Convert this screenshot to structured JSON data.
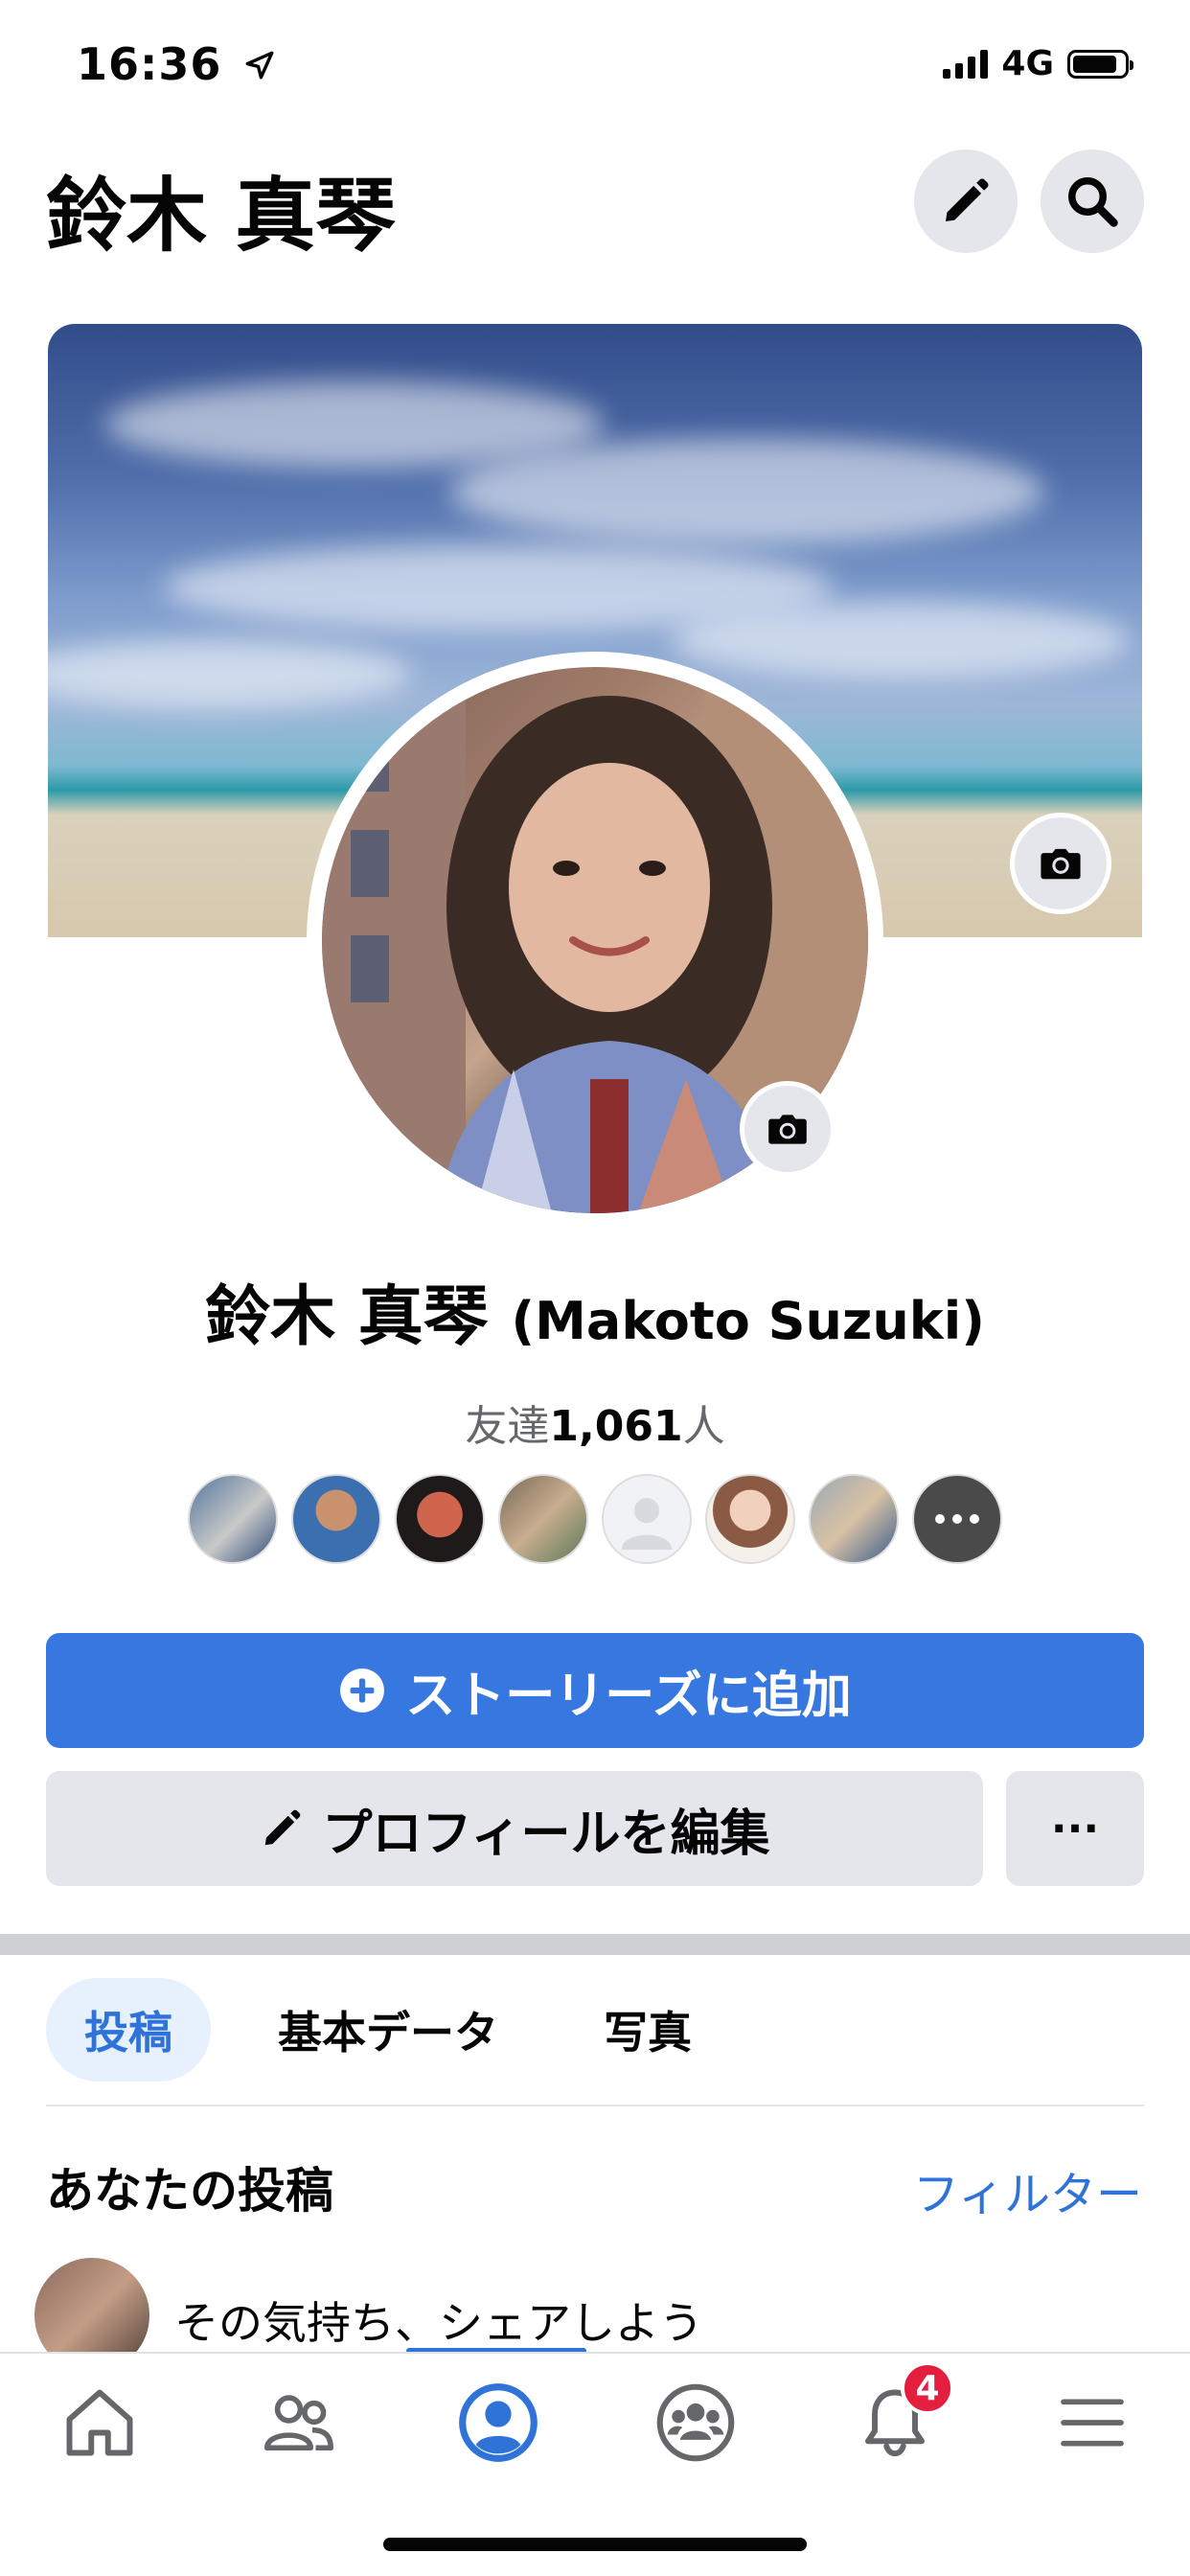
{
  "status_bar": {
    "time": "16:36",
    "network": "4G",
    "icons": [
      "location-arrow-icon",
      "signal-icon",
      "battery-icon"
    ]
  },
  "header": {
    "title": "鈴木 真琴",
    "edit_icon": "pencil-icon",
    "search_icon": "search-icon"
  },
  "profile": {
    "name_ja": "鈴木 真琴",
    "name_roman": "(Makoto Suzuki)",
    "friends_prefix": "友達",
    "friends_count": "1,061",
    "friends_suffix": "人",
    "friend_avatars": 8
  },
  "actions": {
    "add_story": "ストーリーズに追加",
    "edit_profile": "プロフィールを編集",
    "more": "···"
  },
  "tabs": [
    {
      "label": "投稿",
      "active": true
    },
    {
      "label": "基本データ",
      "active": false
    },
    {
      "label": "写真",
      "active": false
    }
  ],
  "posts": {
    "title": "あなたの投稿",
    "filter": "フィルター",
    "composer_placeholder": "その気持ち、シェアしよう"
  },
  "bottom_nav": {
    "items": [
      "home-icon",
      "friends-icon",
      "profile-icon",
      "groups-icon",
      "notifications-icon",
      "menu-icon"
    ],
    "active": "profile-icon",
    "notification_badge": "4"
  },
  "colors": {
    "accent": "#3778e0",
    "link": "#2f73d9",
    "badge": "#e41e3f",
    "button_grey": "#e4e6eb"
  }
}
